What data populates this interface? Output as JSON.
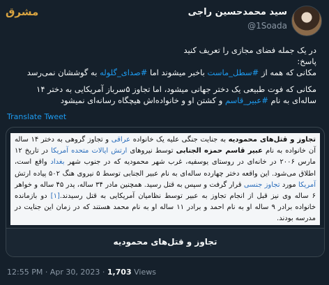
{
  "brand": {
    "logo_text": "مشرق"
  },
  "author": {
    "name": "سید محمدحسین راجی",
    "handle": "@1Soada"
  },
  "tweet": {
    "line1": "در یک جمله فضای مجازی را تعریف کنید",
    "line2": "پاسخ:",
    "line3_pre": "مکانی که همه از ",
    "hashtag1": "#سطل_ماست",
    "line3_mid": " باخبر میشوند اما ",
    "hashtag2": "#صدای_گلوله",
    "line3_post": " به گوششان نمی‌رسد",
    "line4": "مکانی که فوت طبیعی یک دختر جهانی میشود، اما تجاوز ۵سرباز آمریکایی به دختر ۱۴ ساله‌ای به نام",
    "hashtag3": "#عبیر_قاسم",
    "line5_post": " و کشتن او و خانواده‌اش هیچگاه رسانه‌ای نمیشود"
  },
  "translate_label": "Translate Tweet",
  "card": {
    "title_bold": "تجاوز و قتل‌های محمودیه",
    "p1": " به جنایت جنگی علیه یک خانواده ",
    "l_iraqi": "عراقی",
    "p2": " و تجاوز گروهی به دختر ۱۴ ساله آن خانواده به نام ",
    "b_name": "عبیر قاسم حمزه الجنابی",
    "p3": " توسط نیروهای ",
    "l_army": "ارتش ایالات متحده آمریکا",
    "p4": " در تاریخ ۱۲ مارس ۲۰۰۶ در خانه‌ای در روستای یوسفیه، غرب شهر محمودیه که در جنوب شهر ",
    "l_baghdad": "بغداد",
    "p5": " واقع است، اطلاق می‌شود. این واقعه دختر چهارده ساله‌ای به نام عبیر الجنابی توسط ۵ نیروی هنگ ۵۰۲ پیاده ارتش ",
    "l_america": "آمریکا",
    "p6": " مورد ",
    "l_rape": "تجاوز جنسی",
    "p7": " قرار گرفت و سپس به قتل رسید. همچنین مادر ۳۴ ساله، پدر ۴۵ ساله و خواهر ۶ ساله وی نیز قبل از انجام تجاوز به عبیر توسط نظامیان آمریکایی به قتل رسیدند.",
    "ref": "[۱]",
    "p8": " دو بازمانده خانواده برادر ۹ ساله او به نام احمد و برادر ۱۱ ساله او به نام محمد هستند که در زمان این جنایت در مدرسه بودند.",
    "link_title": "تجاوز و قتل‌های محمودیه"
  },
  "meta": {
    "time": "12:55 PM · Apr 30, 2023 · ",
    "views": "1,703",
    "views_label": " Views"
  }
}
